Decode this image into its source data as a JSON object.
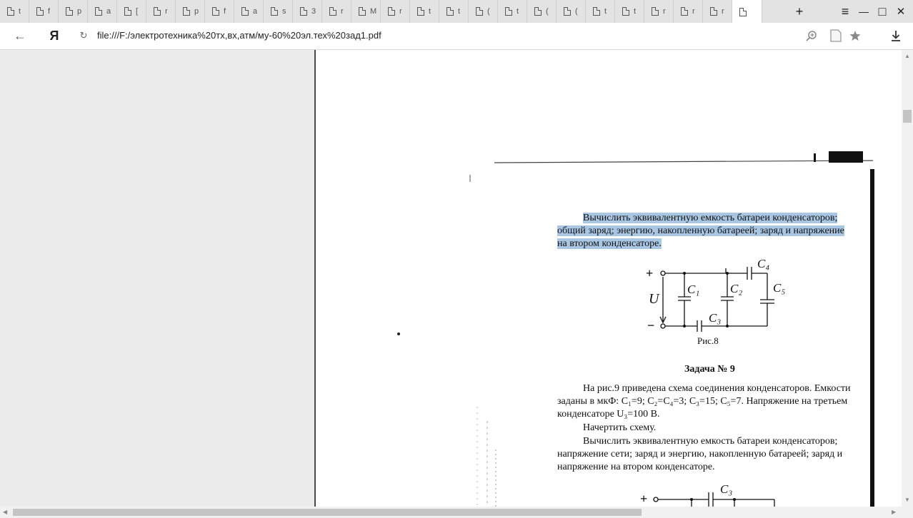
{
  "browser": {
    "tab_letters": [
      "t",
      "f",
      "p",
      "a",
      "[",
      "r",
      "p",
      "f",
      "a",
      "s",
      "3",
      "r",
      "M",
      "r",
      "t",
      "t",
      "(",
      "t",
      "(",
      "(",
      "t",
      "t",
      "r",
      "r",
      "r"
    ],
    "new_tab": "+",
    "controls": {
      "menu": "≡",
      "minimize": "—",
      "maximize": "□",
      "close": "✕"
    },
    "back": "←",
    "logo": "Я",
    "reload": "↻",
    "url": "file:///F:/электротехника%20тх,вх,атм/му-60%20эл.тех%20зад1.pdf"
  },
  "pdf": {
    "task8_lines": [
      "Вычислить эквивалентную емкость батареи конденсаторов;",
      "общий заряд; энергию, накопленную батареей; заряд и напряжение",
      "на втором конденсаторе."
    ],
    "fig8": {
      "plus": "+",
      "minus": "−",
      "u": "U",
      "c1": "C₁",
      "c2": "C₂",
      "c3": "C₃",
      "c4": "C₄",
      "c5": "C₅",
      "caption": "Рис.8"
    },
    "task9": {
      "title": "Задача № 9",
      "lines": [
        "На рис.9 приведена схема соединения конденсаторов. Емкости",
        "заданы в мкФ: C₁=9; C₂=C₄=3; C₃=15; C₅=7. Напряжение на третьем",
        "конденсаторе U₃=100 В.",
        "Начертить схему.",
        "Вычислить эквивалентную емкость батареи конденсаторов;",
        "напряжение сети; заряд и энергию, накопленную батареей; заряд и",
        "напряжение на втором конденсаторе."
      ]
    },
    "fig9_partial": {
      "plus": "+",
      "c3": "C₃"
    }
  }
}
